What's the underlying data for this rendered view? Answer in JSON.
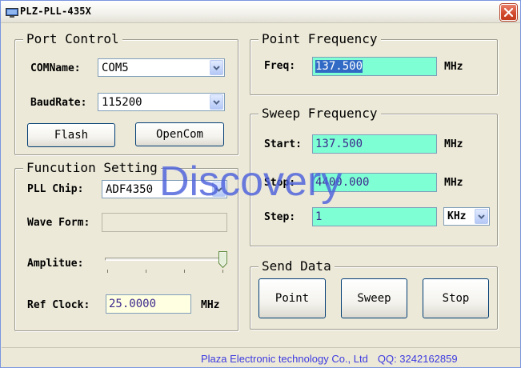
{
  "window": {
    "title": "PLZ-PLL-435X"
  },
  "port_control": {
    "legend": "Port Control",
    "com_label": "COMName:",
    "com_value": "COM5",
    "baud_label": "BaudRate:",
    "baud_value": "115200",
    "flash_button": "Flash",
    "opencom_button": "OpenCom"
  },
  "function_setting": {
    "legend": "Funcution Setting",
    "pll_chip_label": "PLL Chip:",
    "pll_chip_value": "ADF4350",
    "wave_form_label": "Wave Form:",
    "wave_form_value": "",
    "amplitude_label": "Amplitue:",
    "amplitude_level": 1.0,
    "ref_clock_label": "Ref Clock:",
    "ref_clock_value": "25.0000",
    "ref_clock_unit": "MHz"
  },
  "point_frequency": {
    "legend": "Point Frequency",
    "freq_label": "Freq:",
    "freq_value": "137.500",
    "freq_unit": "MHz"
  },
  "sweep_frequency": {
    "legend": "Sweep Frequency",
    "start_label": "Start:",
    "start_value": "137.500",
    "start_unit": "MHz",
    "stop_label": "Stop:",
    "stop_value": "4400.000",
    "stop_unit": "MHz",
    "step_label": "Step:",
    "step_value": "1",
    "step_unit": "KHz"
  },
  "send_data": {
    "legend": "Send Data",
    "point_button": "Point",
    "sweep_button": "Sweep",
    "stop_button": "Stop"
  },
  "watermark": "Discovery",
  "footer": {
    "company": "Plaza Electronic technology Co., Ltd",
    "qq": "QQ: 3242162859"
  },
  "colors": {
    "input_cyan": "#7fffd4",
    "input_yellow": "#ffffe1",
    "footer_text": "#3d3ae0",
    "watermark": "#4c60dc",
    "close_button": "#d24b2e"
  },
  "icons": {
    "app": "computer-monitor-icon",
    "close": "close-x-icon",
    "dropdown": "chevron-down-icon",
    "slider": "slider-thumb-icon"
  }
}
